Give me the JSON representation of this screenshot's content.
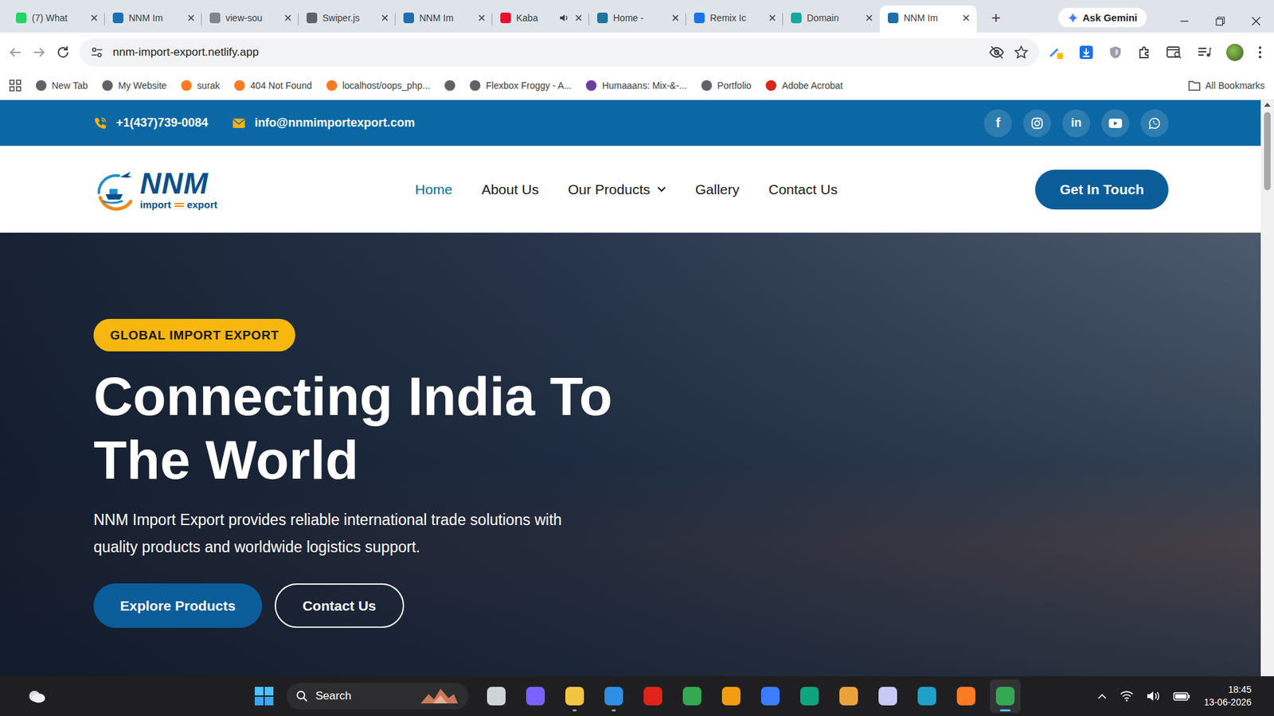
{
  "browser": {
    "tabs": [
      {
        "label": "(7) What",
        "selected": false,
        "playing": false,
        "color": "#25d366"
      },
      {
        "label": "NNM Im",
        "selected": false,
        "playing": false,
        "color": "#1c6fb0"
      },
      {
        "label": "view-sou",
        "selected": false,
        "playing": false,
        "color": "#80868b"
      },
      {
        "label": "Swiper.js",
        "selected": false,
        "playing": false,
        "color": "#5f6368"
      },
      {
        "label": "NNM Im",
        "selected": false,
        "playing": false,
        "color": "#1c6fb0"
      },
      {
        "label": "Kaba",
        "selected": false,
        "playing": true,
        "color": "#e8112d"
      },
      {
        "label": "Home -",
        "selected": false,
        "playing": false,
        "color": "#21759b"
      },
      {
        "label": "Remix Ic",
        "selected": false,
        "playing": false,
        "color": "#1a73e8"
      },
      {
        "label": "Domain",
        "selected": false,
        "playing": false,
        "color": "#12a89d"
      },
      {
        "label": "NNM Im",
        "selected": true,
        "playing": false,
        "color": "#1c6fb0"
      }
    ],
    "new_tab": "+",
    "gemini": "Ask Gemini",
    "address": "nnm-import-export.netlify.app",
    "bookmarks": [
      {
        "label": "New Tab",
        "color": "#5f6368"
      },
      {
        "label": "My Website",
        "color": "#5f6368"
      },
      {
        "label": "surak",
        "color": "#fb7a24"
      },
      {
        "label": "404 Not Found",
        "color": "#fb7a24"
      },
      {
        "label": "localhost/oops_php...",
        "color": "#fb7a24"
      },
      {
        "color": "#5f6368"
      },
      {
        "label": "Flexbox Froggy - A...",
        "color": "#5f6368"
      },
      {
        "label": "Humaaans: Mix-&-...",
        "color": "#6b3fa0"
      },
      {
        "label": "Portfolio",
        "color": "#5f6368"
      },
      {
        "label": "Adobe Acrobat",
        "color": "#d7261e"
      }
    ],
    "all_bookmarks": "All Bookmarks"
  },
  "page": {
    "topbar": {
      "phone": "+1(437)739-0084",
      "email": "info@nnmimportexport.com",
      "socials": [
        {
          "kind": "facebook",
          "glyph": "f"
        },
        {
          "kind": "instagram"
        },
        {
          "kind": "linkedin",
          "glyph": "in"
        },
        {
          "kind": "youtube"
        },
        {
          "kind": "whatsapp"
        }
      ]
    },
    "logo": {
      "name": "NNM",
      "sub1": "import",
      "sub2": "export"
    },
    "nav": [
      {
        "label": "Home",
        "selected": true,
        "dropdown": false
      },
      {
        "label": "About Us",
        "selected": false,
        "dropdown": false
      },
      {
        "label": "Our Products",
        "selected": false,
        "dropdown": true
      },
      {
        "label": "Gallery",
        "selected": false,
        "dropdown": false
      },
      {
        "label": "Contact Us",
        "selected": false,
        "dropdown": false
      }
    ],
    "cta": "Get In Touch",
    "hero": {
      "badge": "GLOBAL IMPORT EXPORT",
      "title_lines": [
        "Connecting India To",
        "The World"
      ],
      "paragraph_lines": [
        "NNM Import Export provides reliable international trade solutions with",
        "quality products and worldwide logistics support."
      ],
      "buttons": [
        {
          "label": "Explore Products",
          "kind": "filled"
        },
        {
          "label": "Contact Us",
          "kind": "outline"
        }
      ]
    }
  },
  "taskbar": {
    "search": "Search",
    "apps": [
      {
        "color": "#d0d4d8",
        "running": false,
        "active": false
      },
      {
        "color": "#7b61ff",
        "running": false,
        "active": false
      },
      {
        "color": "#f4c542",
        "running": true,
        "active": false
      },
      {
        "color": "#2d8fe6",
        "running": true,
        "active": false
      },
      {
        "color": "#e0241b",
        "running": false,
        "active": false
      },
      {
        "color": "#34a853",
        "running": false,
        "active": false
      },
      {
        "color": "#f39c12",
        "running": false,
        "active": false
      },
      {
        "color": "#3d7bff",
        "running": false,
        "active": false
      },
      {
        "color": "#10a37f",
        "running": false,
        "active": false
      },
      {
        "color": "#e9a23b",
        "running": false,
        "active": false
      },
      {
        "color": "#c9c9f5",
        "running": false,
        "active": false
      },
      {
        "color": "#1fa0c8",
        "running": false,
        "active": false
      },
      {
        "color": "#fb7a24",
        "running": false,
        "active": false
      },
      {
        "color": "#34a853",
        "running": true,
        "active": true
      }
    ],
    "time": "18:45",
    "date": "13-06-2026"
  }
}
